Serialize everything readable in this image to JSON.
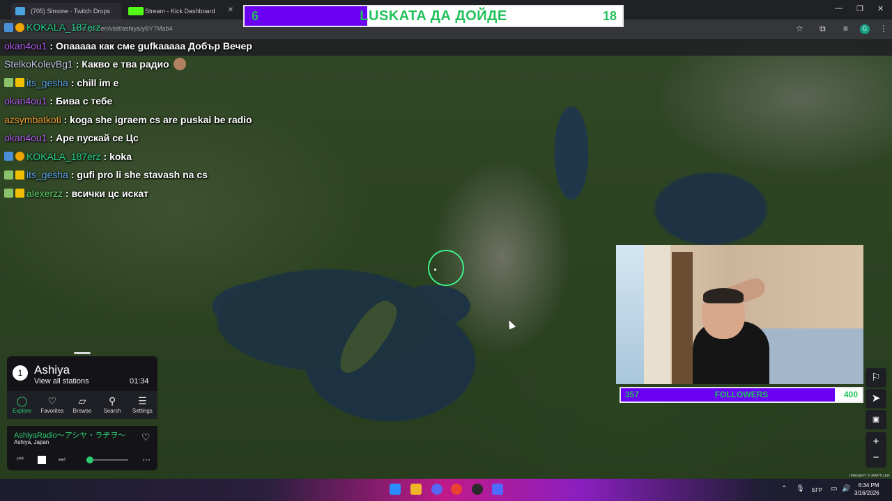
{
  "browser": {
    "tabs": [
      {
        "label": "(705) Simone · Twitch Drops"
      },
      {
        "label": "Stream - Kick Dashboard"
      }
    ],
    "url": "radio.garden/visit/ashiya/yBY7Mab4"
  },
  "goals": {
    "top": {
      "current": "6",
      "title": "LUSKATA ДА ДОЙДЕ",
      "target": "18"
    },
    "followers": {
      "current": "357",
      "title": "FOLLOWERS",
      "target": "400"
    }
  },
  "chat": [
    {
      "user": "KOKALA_187erz",
      "user_color": "#22d38a",
      "badges": [
        "bot",
        "vip"
      ],
      "message": ""
    },
    {
      "user": "okan4ou1",
      "user_color": "#b05cf0",
      "badges": [],
      "message": "Опааааа как сме gufkaaaaa Добър Вечер"
    },
    {
      "user": "StelkoKolevBg1",
      "user_color": "#c4c7e8",
      "badges": [],
      "message": "Какво е тва радио"
    },
    {
      "user": "its_gesha",
      "user_color": "#5fa7f0",
      "badges": [
        "hand",
        "crown"
      ],
      "message": "chill im e"
    },
    {
      "user": "okan4ou1",
      "user_color": "#b05cf0",
      "badges": [],
      "message": "Бива с тебе"
    },
    {
      "user": "azsymbatkoti",
      "user_color": "#f0a030",
      "badges": [],
      "message": "koga she igraem cs are puskai be radio"
    },
    {
      "user": "okan4ou1",
      "user_color": "#b05cf0",
      "badges": [],
      "message": "Аре пускай се Цс"
    },
    {
      "user": "KOKALA_187erz",
      "user_color": "#22d38a",
      "badges": [
        "bot",
        "vip"
      ],
      "message": "koka"
    },
    {
      "user": "its_gesha",
      "user_color": "#5fa7f0",
      "badges": [
        "hand",
        "crown"
      ],
      "message": "gufi pro li she stavash na cs"
    },
    {
      "user": "alexerzz",
      "user_color": "#5fd06a",
      "badges": [
        "hand",
        "crown"
      ],
      "message": "всички цс искат"
    }
  ],
  "radio": {
    "station_count": "1",
    "place": "Ashiya",
    "view_all": "View all stations",
    "time": "01:34",
    "nav": [
      {
        "label": "Explore",
        "icon": "explore-icon",
        "glyph": "◯"
      },
      {
        "label": "Favorites",
        "icon": "heart-icon",
        "glyph": "♡"
      },
      {
        "label": "Browse",
        "icon": "map-icon",
        "glyph": "▱"
      },
      {
        "label": "Search",
        "icon": "search-icon",
        "glyph": "⚲"
      },
      {
        "label": "Settings",
        "icon": "menu-icon",
        "glyph": "☰"
      }
    ],
    "now_playing": "AshiyaRadio〜アシヤ・ラヂヲ〜",
    "location": "Ashiya, Japan",
    "volume_fraction": 0.08
  },
  "map": {
    "attribution": "IMAGERY © MAPTILER"
  },
  "map_controls": [
    {
      "name": "balloon-icon",
      "glyph": "⚐"
    },
    {
      "name": "locate-icon",
      "glyph": "➤"
    },
    {
      "name": "lock-icon",
      "glyph": "🔒"
    },
    {
      "name": "zoom-in-button",
      "glyph": "+"
    },
    {
      "name": "zoom-out-button",
      "glyph": "−"
    }
  ],
  "taskbar": {
    "language": "БГР",
    "time": "6:34 PM",
    "date": "3/16/2026"
  },
  "colors": {
    "goal_fill": "#6a00f4",
    "goal_text": "#22c25b",
    "marker": "#3df08a",
    "radio_accent": "#2ecc71"
  }
}
